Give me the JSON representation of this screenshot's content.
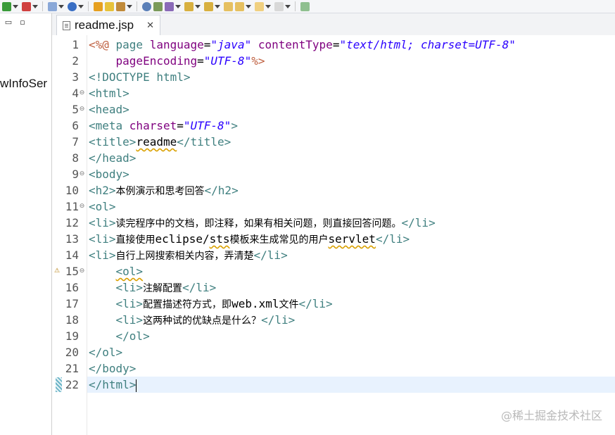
{
  "toolbar": {
    "icons": [
      "run-icon",
      "debug-icon",
      "new-server-icon",
      "globe-icon",
      "new-file-icon",
      "open-folder-icon",
      "tools-icon",
      "search-icon",
      "refactor-icon",
      "save-icon",
      "next-annotation-icon",
      "prev-annotation-icon",
      "back-icon",
      "forward-icon",
      "back-arrow-icon",
      "forward-arrow-icon",
      "pin-editor-icon"
    ],
    "colors": {
      "green": "#3a9b3a",
      "red": "#d04040",
      "blue": "#3a6fc4",
      "orange": "#e6a020",
      "yellow": "#e7c23a"
    }
  },
  "left_panel": {
    "minimize_glyph": "▭",
    "maximize_glyph": "▫",
    "item_label": "wInfoSer"
  },
  "tab": {
    "label": "readme.jsp",
    "close": "✕"
  },
  "editor": {
    "lines": [
      {
        "n": "1",
        "fold": "",
        "segs": [
          {
            "c": "jsp",
            "t": "<%@ "
          },
          {
            "c": "tag",
            "t": "page "
          },
          {
            "c": "attr",
            "t": "language"
          },
          {
            "c": "txt",
            "t": "="
          },
          {
            "c": "val",
            "t": "\"java\""
          },
          {
            "c": "txt",
            "t": " "
          },
          {
            "c": "attr",
            "t": "contentType"
          },
          {
            "c": "txt",
            "t": "="
          },
          {
            "c": "val",
            "t": "\"text/html; charset=UTF-8\""
          }
        ]
      },
      {
        "n": "2",
        "fold": "",
        "segs": [
          {
            "c": "txt",
            "t": "    "
          },
          {
            "c": "attr",
            "t": "pageEncoding"
          },
          {
            "c": "txt",
            "t": "="
          },
          {
            "c": "val",
            "t": "\"UTF-8\""
          },
          {
            "c": "jsp",
            "t": "%>"
          }
        ]
      },
      {
        "n": "3",
        "fold": "",
        "segs": [
          {
            "c": "tag",
            "t": "<!DOCTYPE html>"
          }
        ]
      },
      {
        "n": "4",
        "fold": "⊖",
        "segs": [
          {
            "c": "tag",
            "t": "<html>"
          }
        ]
      },
      {
        "n": "5",
        "fold": "⊖",
        "segs": [
          {
            "c": "tag",
            "t": "<head>"
          }
        ]
      },
      {
        "n": "6",
        "fold": "",
        "segs": [
          {
            "c": "tag",
            "t": "<meta "
          },
          {
            "c": "attr",
            "t": "charset"
          },
          {
            "c": "txt",
            "t": "="
          },
          {
            "c": "val",
            "t": "\"UTF-8\""
          },
          {
            "c": "tag",
            "t": ">"
          }
        ]
      },
      {
        "n": "7",
        "fold": "",
        "segs": [
          {
            "c": "tag",
            "t": "<title>"
          },
          {
            "c": "txt sq",
            "t": "readme"
          },
          {
            "c": "tag",
            "t": "</title>"
          }
        ]
      },
      {
        "n": "8",
        "fold": "",
        "segs": [
          {
            "c": "tag",
            "t": "</head>"
          }
        ]
      },
      {
        "n": "9",
        "fold": "⊖",
        "segs": [
          {
            "c": "tag",
            "t": "<body>"
          }
        ]
      },
      {
        "n": "10",
        "fold": "",
        "segs": [
          {
            "c": "tag",
            "t": "<h2>"
          },
          {
            "c": "txt cjk",
            "t": "本例演示和思考回答"
          },
          {
            "c": "tag",
            "t": "</h2>"
          }
        ]
      },
      {
        "n": "11",
        "fold": "⊖",
        "segs": [
          {
            "c": "tag",
            "t": "<ol>"
          }
        ]
      },
      {
        "n": "12",
        "fold": "",
        "segs": [
          {
            "c": "tag",
            "t": "<li>"
          },
          {
            "c": "txt cjk",
            "t": "读完程序中的文档，即注释，如果有相关问题，则直接回答问题。"
          },
          {
            "c": "tag",
            "t": "</li>"
          }
        ]
      },
      {
        "n": "13",
        "fold": "",
        "segs": [
          {
            "c": "tag",
            "t": "<li>"
          },
          {
            "c": "txt cjk",
            "t": "直接使用"
          },
          {
            "c": "txt",
            "t": "eclipse/"
          },
          {
            "c": "txt sq",
            "t": "sts"
          },
          {
            "c": "txt cjk",
            "t": "模板来生成常见的用户"
          },
          {
            "c": "txt sq",
            "t": "servlet"
          },
          {
            "c": "tag",
            "t": "</li>"
          }
        ]
      },
      {
        "n": "14",
        "fold": "",
        "segs": [
          {
            "c": "tag",
            "t": "<li>"
          },
          {
            "c": "txt cjk",
            "t": "自行上网搜索相关内容，弄清楚"
          },
          {
            "c": "tag",
            "t": "</li>"
          }
        ]
      },
      {
        "n": "15",
        "fold": "⊖",
        "warn": true,
        "segs": [
          {
            "c": "txt",
            "t": "    "
          },
          {
            "c": "tag sq",
            "t": "<ol>"
          }
        ]
      },
      {
        "n": "16",
        "fold": "",
        "segs": [
          {
            "c": "txt",
            "t": "    "
          },
          {
            "c": "tag",
            "t": "<li>"
          },
          {
            "c": "txt cjk",
            "t": "注解配置"
          },
          {
            "c": "tag",
            "t": "</li>"
          }
        ]
      },
      {
        "n": "17",
        "fold": "",
        "segs": [
          {
            "c": "txt",
            "t": "    "
          },
          {
            "c": "tag",
            "t": "<li>"
          },
          {
            "c": "txt cjk",
            "t": "配置描述符方式，即"
          },
          {
            "c": "txt",
            "t": "web.xml"
          },
          {
            "c": "txt cjk",
            "t": "文件"
          },
          {
            "c": "tag",
            "t": "</li>"
          }
        ]
      },
      {
        "n": "18",
        "fold": "",
        "segs": [
          {
            "c": "txt",
            "t": "    "
          },
          {
            "c": "tag",
            "t": "<li>"
          },
          {
            "c": "txt cjk",
            "t": "这两种试的优缺点是什么？"
          },
          {
            "c": "tag",
            "t": "</li>"
          }
        ]
      },
      {
        "n": "19",
        "fold": "",
        "segs": [
          {
            "c": "txt",
            "t": "    "
          },
          {
            "c": "tag",
            "t": "</ol>"
          }
        ]
      },
      {
        "n": "20",
        "fold": "",
        "segs": [
          {
            "c": "tag",
            "t": "</ol>"
          }
        ]
      },
      {
        "n": "21",
        "fold": "",
        "segs": [
          {
            "c": "tag",
            "t": "</body>"
          }
        ]
      },
      {
        "n": "22",
        "fold": "",
        "current": true,
        "segs": [
          {
            "c": "tag",
            "t": "</html>"
          }
        ]
      }
    ]
  },
  "watermark": "@稀土掘金技术社区"
}
